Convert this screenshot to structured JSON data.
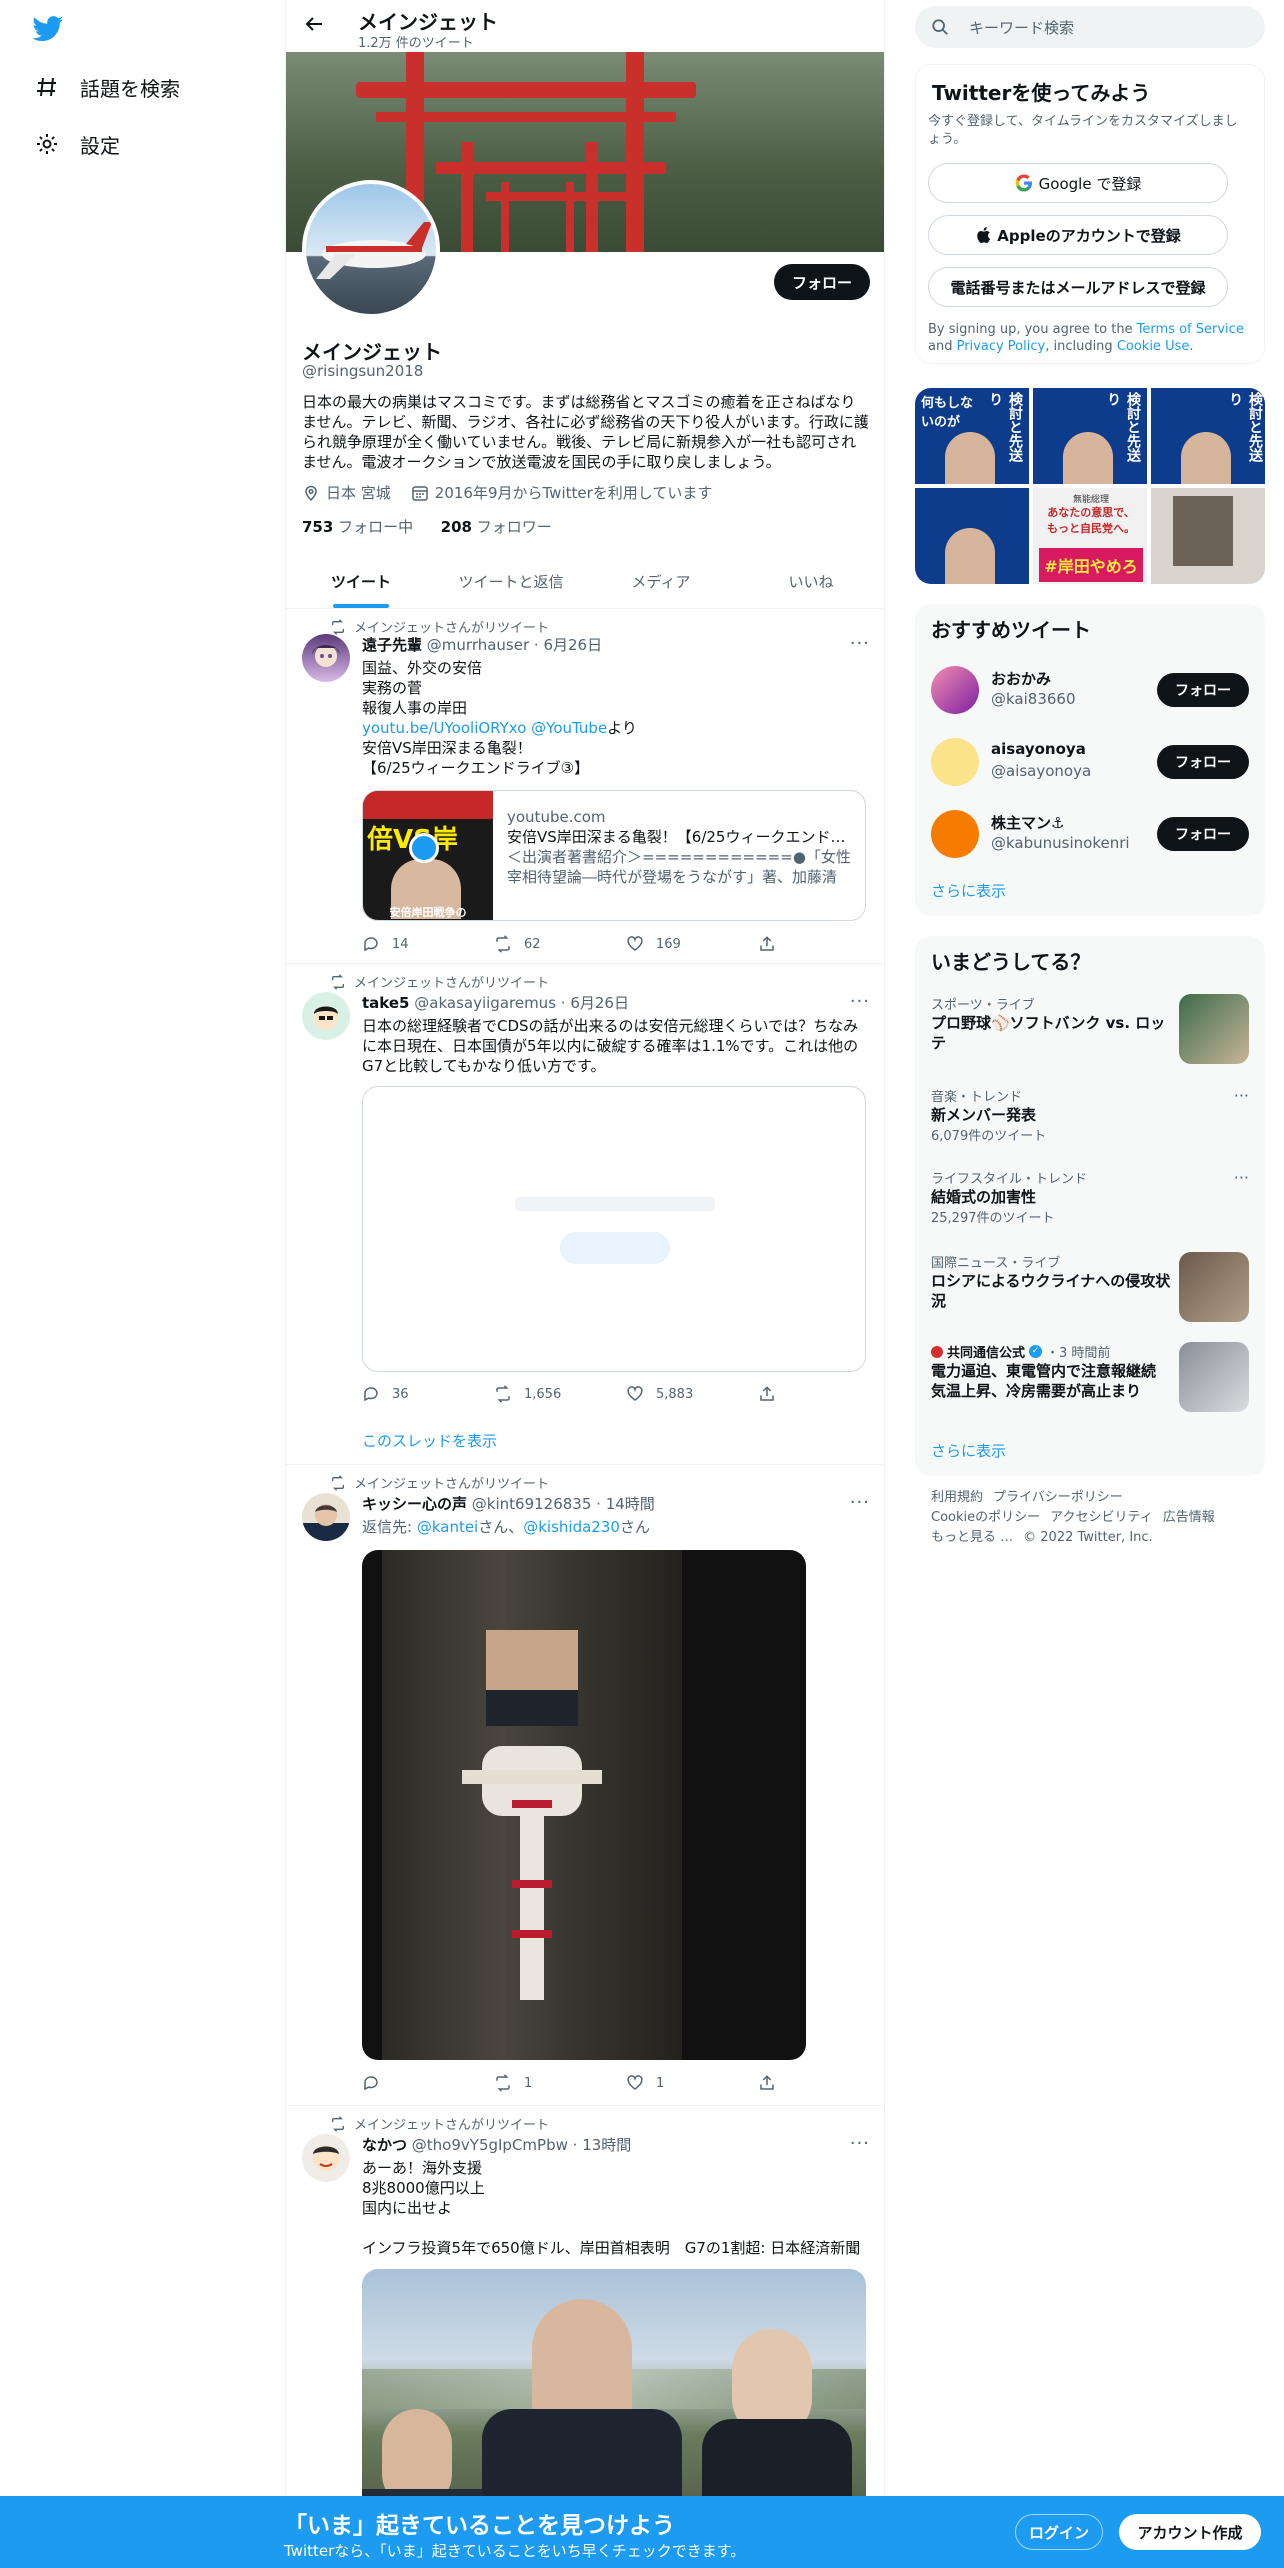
{
  "nav": {
    "explore_label": "話題を検索",
    "settings_label": "設定"
  },
  "header": {
    "name": "メインジェット",
    "tweet_count": "1.2万 件のツイート"
  },
  "profile": {
    "follow_label": "フォロー",
    "display_name": "メインジェット",
    "handle": "@risingsun2018",
    "bio": "日本の最大の病巣はマスコミです。まずは総務省とマスゴミの癒着を正さねばなりません。テレビ、新聞、ラジオ、各社に必ず総務省の天下り役人がいます。行政に護られ競争原理が全く働いていません。戦後、テレビ局に新規参入が一社も認可されません。電波オークションで放送電波を国民の手に取り戻しましょう。",
    "location": "日本 宮城",
    "joined": "2016年9月からTwitterを利用しています",
    "following_count": "753",
    "following_label": "フォロー中",
    "followers_count": "208",
    "followers_label": "フォロワー"
  },
  "tabs": [
    "ツイート",
    "ツイートと返信",
    "メディア",
    "いいね"
  ],
  "tweets": [
    {
      "retweet_label": "メインジェットさんがリツイート",
      "display_name": "遠子先輩",
      "handle": "@murrhauser",
      "date": "6月26日",
      "lines": [
        "国益、外交の安倍",
        "実務の菅",
        "報復人事の岸田"
      ],
      "link": "youtu.be/UYooliORYxo",
      "mention": "@YouTube",
      "link_suffix": "より",
      "lines2": [
        "安倍VS岸田深まる亀裂！",
        "【6/25ウィークエンドライブ③】"
      ],
      "card_domain": "youtube.com",
      "card_title": "安倍VS岸田深まる亀裂！【6/25ウィークエンドラ...",
      "card_desc": "＜出演者著書紹介＞============●「女性宰相待望論―時代が登場をうながす」著、加藤清隆...",
      "thumb_text": "倍VS岸",
      "thumb_caption": "安倍岸田戦争の",
      "replies": "14",
      "retweets": "62",
      "likes": "169"
    },
    {
      "retweet_label": "メインジェットさんがリツイート",
      "display_name": "take5",
      "handle": "@akasayiigaremus",
      "date": "6月26日",
      "body": "日本の総理経験者でCDSの話が出来るのは安倍元総理くらいでは？ちなみに本日現在、日本国債が5年以内に破綻する確率は1.1%です。これは他のG7と比較してもかなり低い方です。",
      "replies": "36",
      "retweets": "1,656",
      "likes": "5,883",
      "show_thread": "このスレッドを表示"
    },
    {
      "retweet_label": "メインジェットさんがリツイート",
      "display_name": "キッシー心の声",
      "handle": "@kint69126835",
      "date": "14時間",
      "reply_prefix": "返信先: ",
      "reply_to_1": "@kantei",
      "reply_mid": "さん、",
      "reply_to_2": "@kishida230",
      "reply_suffix": "さん",
      "replies": "",
      "retweets": "1",
      "likes": "1"
    },
    {
      "retweet_label": "メインジェットさんがリツイート",
      "display_name": "なかつ",
      "handle": "@tho9vY5gIpCmPbw",
      "date": "13時間",
      "lines": [
        "あーあ！海外支援",
        "8兆8000億円以上",
        "国内に出せよ"
      ],
      "line_after": "インフラ投資5年で650億ドル、岸田首相表明　G7の1割超: 日本経済新聞"
    }
  ],
  "right": {
    "search_placeholder": "キーワード検索",
    "signup_title": "Twitterを使ってみよう",
    "signup_sub": "今すぐ登録して、タイムラインをカスタマイズしましょう。",
    "google_btn": "Google で登録",
    "apple_btn": "Appleのアカウントで登録",
    "phone_btn": "電話番号またはメールアドレスで登録",
    "terms_pre": "By signing up, you agree to the ",
    "terms_link": "Terms of Service",
    "terms_and": " and ",
    "privacy_link": "Privacy Policy",
    "terms_incl": ", including ",
    "cookie_link": "Cookie Use",
    "terms_end": ".",
    "media_texts": [
      "検討と先送り",
      "何もしないのが",
      "あなたの意思で、",
      "もっと自民党へ。",
      "#岸田やめろ",
      "無能総理"
    ],
    "suggested_title": "おすすめツイート",
    "suggested": [
      {
        "name": "おおかみ",
        "handle": "@kai83660"
      },
      {
        "name": "aisayonoya",
        "handle": "@aisayonoya"
      },
      {
        "name": "株主マン⚓",
        "handle": "@kabunusinokenri"
      }
    ],
    "suggested_follow": "フォロー",
    "show_more": "さらに表示",
    "trends_title": "いまどうしてる？",
    "trends": [
      {
        "cat": "スポーツ・ライブ",
        "title": "プロ野球⚾ソフトバンク vs. ロッテ",
        "count": ""
      },
      {
        "cat": "音楽・トレンド",
        "title": "新メンバー発表",
        "count": "6,079件のツイート"
      },
      {
        "cat": "ライフスタイル・トレンド",
        "title": "結婚式の加害性",
        "count": "25,297件のツイート"
      },
      {
        "cat": "国際ニュース・ライブ",
        "title": "ロシアによるウクライナへの侵攻状況",
        "count": ""
      },
      {
        "cat": "共同通信公式",
        "time": "・3 時間前",
        "title": "電力逼迫、東電管内で注意報継続 気温上昇、冷房需要が高止まり",
        "count": ""
      }
    ],
    "footer": [
      "利用規約",
      "プライバシーポリシー",
      "Cookieのポリシー",
      "アクセシビリティ",
      "広告情報",
      "もっと見る …",
      "© 2022 Twitter, Inc."
    ]
  },
  "bottom": {
    "title": "「いま」起きていることを見つけよう",
    "sub": "Twitterなら、「いま」起きていることをいち早くチェックできます。",
    "login": "ログイン",
    "signup": "アカウント作成"
  },
  "colors": {
    "accent": "#1d9bf0",
    "text": "#0f1419",
    "muted": "#536471"
  }
}
